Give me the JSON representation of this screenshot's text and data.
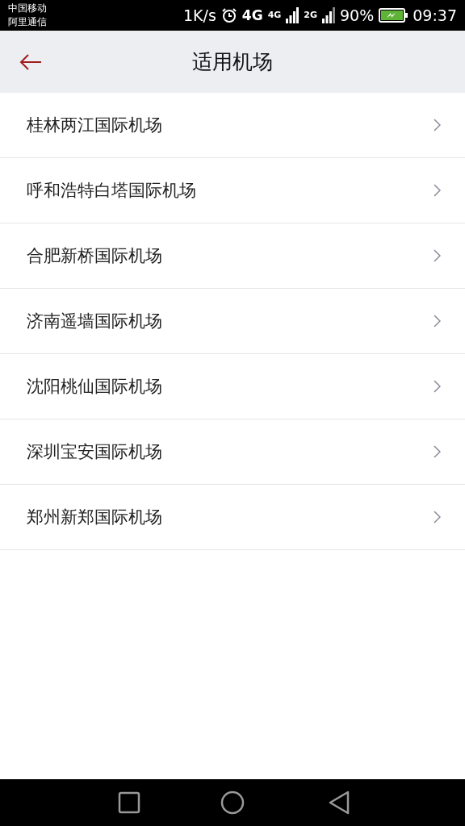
{
  "status_bar": {
    "carrier_1": "中国移动",
    "carrier_2": "阿里通信",
    "speed": "1K/s",
    "network_1": "4G",
    "network_2": "4G",
    "network_3": "2G",
    "battery": "90%",
    "time": "09:37"
  },
  "header": {
    "title": "适用机场"
  },
  "airports": [
    {
      "name": "桂林两江国际机场"
    },
    {
      "name": "呼和浩特白塔国际机场"
    },
    {
      "name": "合肥新桥国际机场"
    },
    {
      "name": "济南遥墙国际机场"
    },
    {
      "name": "沈阳桃仙国际机场"
    },
    {
      "name": "深圳宝安国际机场"
    },
    {
      "name": "郑州新郑国际机场"
    }
  ]
}
